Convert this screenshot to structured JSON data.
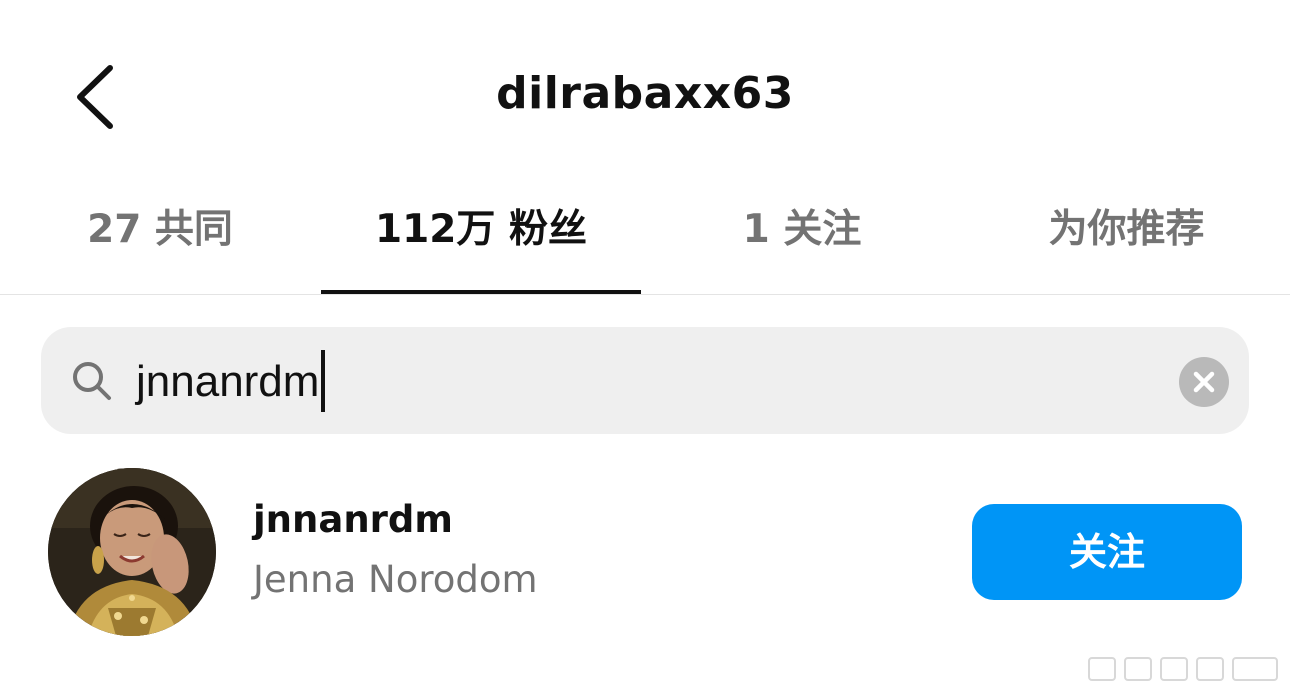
{
  "header": {
    "title": "dilrabaxx63",
    "back_icon": "chevron-left-icon"
  },
  "tabs": [
    {
      "label": "27 共同",
      "active": false
    },
    {
      "label": "112万 粉丝",
      "active": true
    },
    {
      "label": "1 关注",
      "active": false
    },
    {
      "label": "为你推荐",
      "active": false
    }
  ],
  "search": {
    "icon": "search-icon",
    "value": "jnnanrdm",
    "clear_icon": "close-icon"
  },
  "results": [
    {
      "username": "jnnanrdm",
      "full_name": "Jenna Norodom",
      "follow_label": "关注"
    }
  ],
  "colors": {
    "accent": "#0095f6",
    "secondary_text": "#737373",
    "search_bg": "#efefef"
  }
}
